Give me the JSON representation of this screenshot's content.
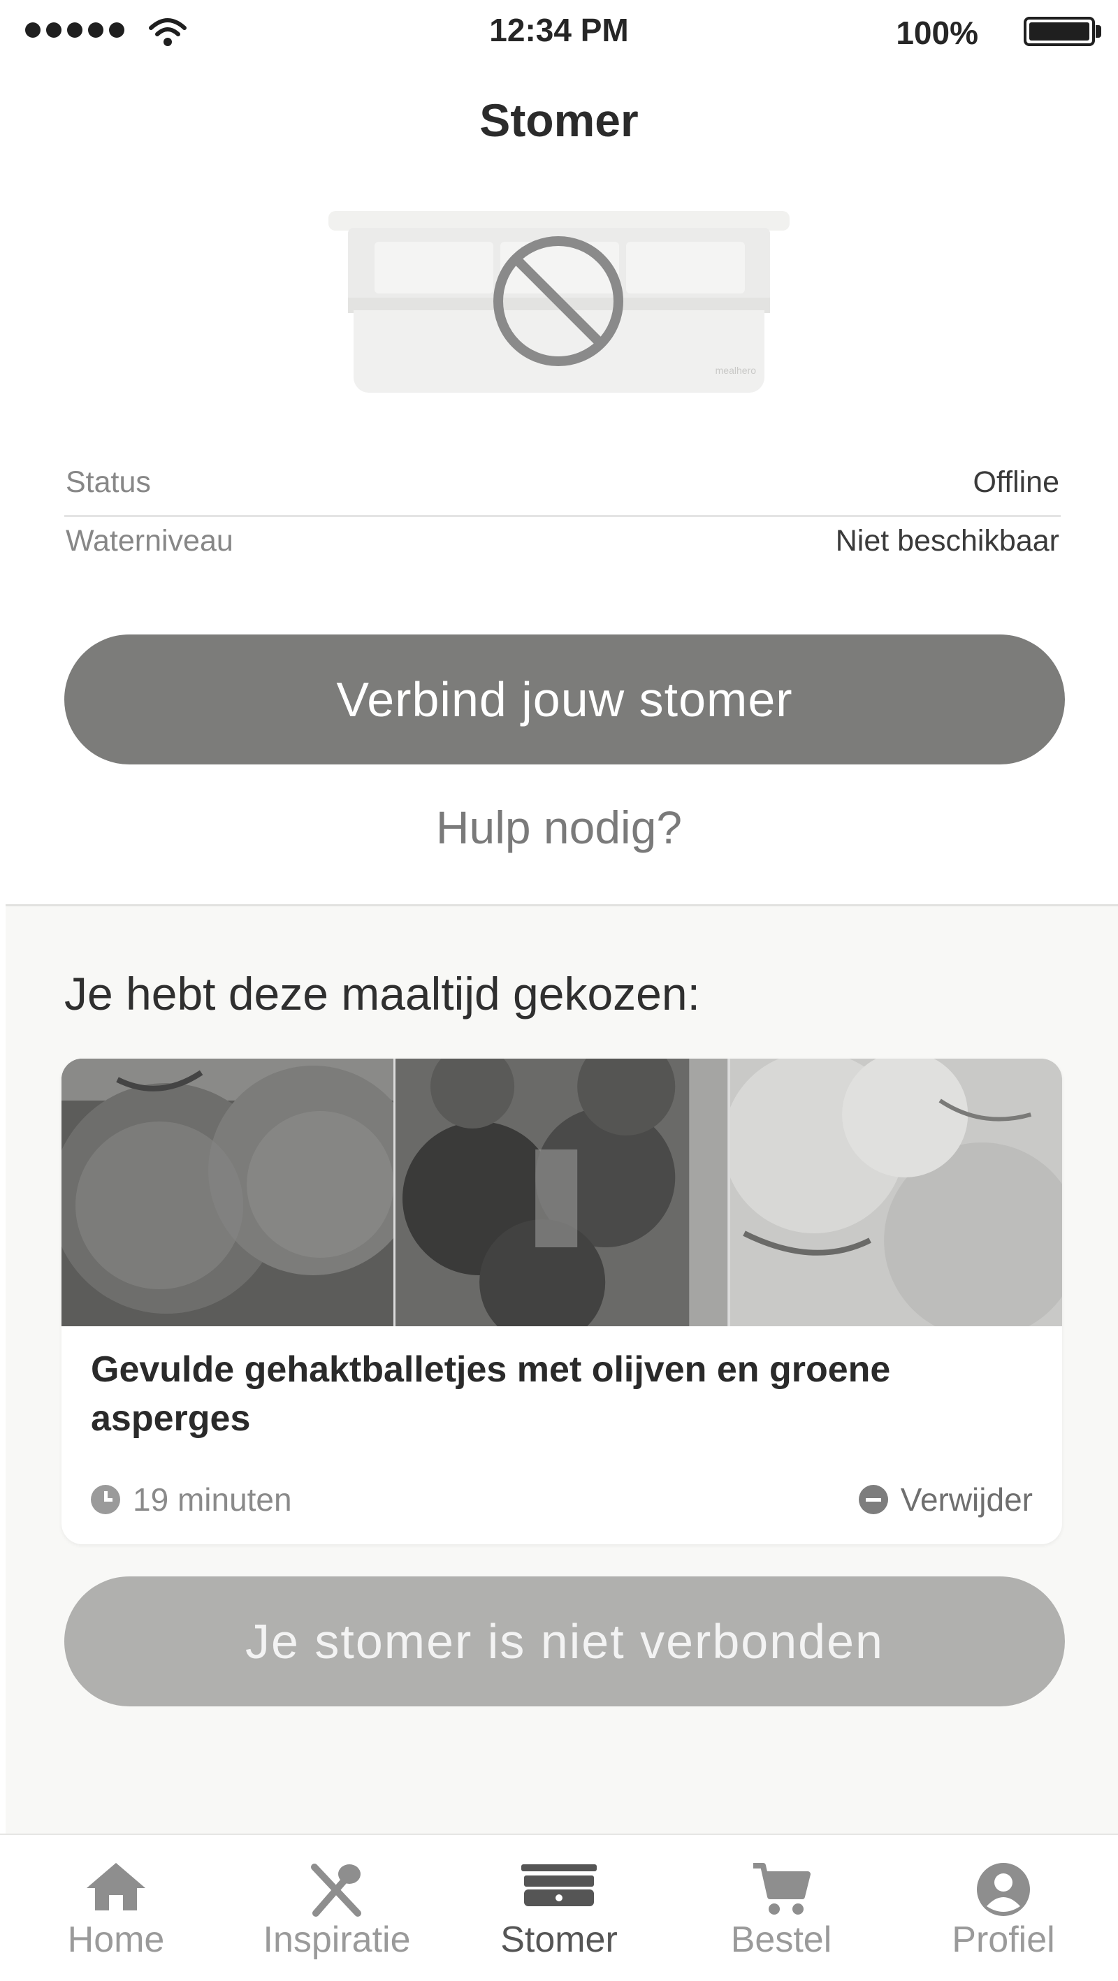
{
  "status_bar": {
    "time": "12:34 PM",
    "battery": "100%"
  },
  "header": {
    "title": "Stomer"
  },
  "device": {
    "illustration": "steamer-device",
    "overlay_icon": "no-entry-icon"
  },
  "info": {
    "status_label": "Status",
    "status_value": "Offline",
    "water_label": "Waterniveau",
    "water_value": "Niet beschikbaar"
  },
  "actions": {
    "connect_label": "Verbind jouw stomer",
    "help_label": "Hulp nodig?"
  },
  "meal_section": {
    "heading": "Je hebt deze maaltijd gekozen:",
    "meal": {
      "title": "Gevulde gehaktballetjes met olijven en groene asperges",
      "time": "19 minuten",
      "remove_label": "Verwijder",
      "photos": [
        "meatballs-photo",
        "broccoli-photo",
        "rice-photo"
      ]
    },
    "disabled_button_label": "Je stomer is niet verbonden"
  },
  "tabbar": {
    "items": [
      {
        "label": "Home",
        "icon": "home-icon"
      },
      {
        "label": "Inspiratie",
        "icon": "utensils-icon"
      },
      {
        "label": "Stomer",
        "icon": "steamer-icon"
      },
      {
        "label": "Bestel",
        "icon": "cart-icon"
      },
      {
        "label": "Profiel",
        "icon": "profile-icon"
      }
    ],
    "active_index": 2
  },
  "colors": {
    "primary_button": "#7c7c7a",
    "disabled_button": "#b0b0ae",
    "section_bg": "#f8f8f6"
  }
}
